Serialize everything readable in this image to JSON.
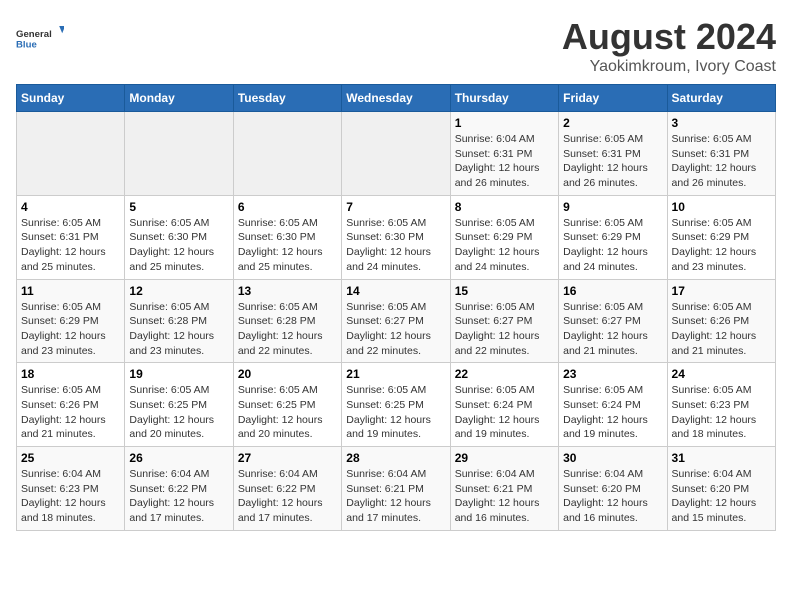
{
  "logo": {
    "brand1": "General",
    "brand2": "Blue"
  },
  "title": "August 2024",
  "subtitle": "Yaokimkroum, Ivory Coast",
  "days_of_week": [
    "Sunday",
    "Monday",
    "Tuesday",
    "Wednesday",
    "Thursday",
    "Friday",
    "Saturday"
  ],
  "weeks": [
    [
      {
        "day": "",
        "info": ""
      },
      {
        "day": "",
        "info": ""
      },
      {
        "day": "",
        "info": ""
      },
      {
        "day": "",
        "info": ""
      },
      {
        "day": "1",
        "info": "Sunrise: 6:04 AM\nSunset: 6:31 PM\nDaylight: 12 hours\nand 26 minutes."
      },
      {
        "day": "2",
        "info": "Sunrise: 6:05 AM\nSunset: 6:31 PM\nDaylight: 12 hours\nand 26 minutes."
      },
      {
        "day": "3",
        "info": "Sunrise: 6:05 AM\nSunset: 6:31 PM\nDaylight: 12 hours\nand 26 minutes."
      }
    ],
    [
      {
        "day": "4",
        "info": "Sunrise: 6:05 AM\nSunset: 6:31 PM\nDaylight: 12 hours\nand 25 minutes."
      },
      {
        "day": "5",
        "info": "Sunrise: 6:05 AM\nSunset: 6:30 PM\nDaylight: 12 hours\nand 25 minutes."
      },
      {
        "day": "6",
        "info": "Sunrise: 6:05 AM\nSunset: 6:30 PM\nDaylight: 12 hours\nand 25 minutes."
      },
      {
        "day": "7",
        "info": "Sunrise: 6:05 AM\nSunset: 6:30 PM\nDaylight: 12 hours\nand 24 minutes."
      },
      {
        "day": "8",
        "info": "Sunrise: 6:05 AM\nSunset: 6:29 PM\nDaylight: 12 hours\nand 24 minutes."
      },
      {
        "day": "9",
        "info": "Sunrise: 6:05 AM\nSunset: 6:29 PM\nDaylight: 12 hours\nand 24 minutes."
      },
      {
        "day": "10",
        "info": "Sunrise: 6:05 AM\nSunset: 6:29 PM\nDaylight: 12 hours\nand 23 minutes."
      }
    ],
    [
      {
        "day": "11",
        "info": "Sunrise: 6:05 AM\nSunset: 6:29 PM\nDaylight: 12 hours\nand 23 minutes."
      },
      {
        "day": "12",
        "info": "Sunrise: 6:05 AM\nSunset: 6:28 PM\nDaylight: 12 hours\nand 23 minutes."
      },
      {
        "day": "13",
        "info": "Sunrise: 6:05 AM\nSunset: 6:28 PM\nDaylight: 12 hours\nand 22 minutes."
      },
      {
        "day": "14",
        "info": "Sunrise: 6:05 AM\nSunset: 6:27 PM\nDaylight: 12 hours\nand 22 minutes."
      },
      {
        "day": "15",
        "info": "Sunrise: 6:05 AM\nSunset: 6:27 PM\nDaylight: 12 hours\nand 22 minutes."
      },
      {
        "day": "16",
        "info": "Sunrise: 6:05 AM\nSunset: 6:27 PM\nDaylight: 12 hours\nand 21 minutes."
      },
      {
        "day": "17",
        "info": "Sunrise: 6:05 AM\nSunset: 6:26 PM\nDaylight: 12 hours\nand 21 minutes."
      }
    ],
    [
      {
        "day": "18",
        "info": "Sunrise: 6:05 AM\nSunset: 6:26 PM\nDaylight: 12 hours\nand 21 minutes."
      },
      {
        "day": "19",
        "info": "Sunrise: 6:05 AM\nSunset: 6:25 PM\nDaylight: 12 hours\nand 20 minutes."
      },
      {
        "day": "20",
        "info": "Sunrise: 6:05 AM\nSunset: 6:25 PM\nDaylight: 12 hours\nand 20 minutes."
      },
      {
        "day": "21",
        "info": "Sunrise: 6:05 AM\nSunset: 6:25 PM\nDaylight: 12 hours\nand 19 minutes."
      },
      {
        "day": "22",
        "info": "Sunrise: 6:05 AM\nSunset: 6:24 PM\nDaylight: 12 hours\nand 19 minutes."
      },
      {
        "day": "23",
        "info": "Sunrise: 6:05 AM\nSunset: 6:24 PM\nDaylight: 12 hours\nand 19 minutes."
      },
      {
        "day": "24",
        "info": "Sunrise: 6:05 AM\nSunset: 6:23 PM\nDaylight: 12 hours\nand 18 minutes."
      }
    ],
    [
      {
        "day": "25",
        "info": "Sunrise: 6:04 AM\nSunset: 6:23 PM\nDaylight: 12 hours\nand 18 minutes."
      },
      {
        "day": "26",
        "info": "Sunrise: 6:04 AM\nSunset: 6:22 PM\nDaylight: 12 hours\nand 17 minutes."
      },
      {
        "day": "27",
        "info": "Sunrise: 6:04 AM\nSunset: 6:22 PM\nDaylight: 12 hours\nand 17 minutes."
      },
      {
        "day": "28",
        "info": "Sunrise: 6:04 AM\nSunset: 6:21 PM\nDaylight: 12 hours\nand 17 minutes."
      },
      {
        "day": "29",
        "info": "Sunrise: 6:04 AM\nSunset: 6:21 PM\nDaylight: 12 hours\nand 16 minutes."
      },
      {
        "day": "30",
        "info": "Sunrise: 6:04 AM\nSunset: 6:20 PM\nDaylight: 12 hours\nand 16 minutes."
      },
      {
        "day": "31",
        "info": "Sunrise: 6:04 AM\nSunset: 6:20 PM\nDaylight: 12 hours\nand 15 minutes."
      }
    ]
  ]
}
